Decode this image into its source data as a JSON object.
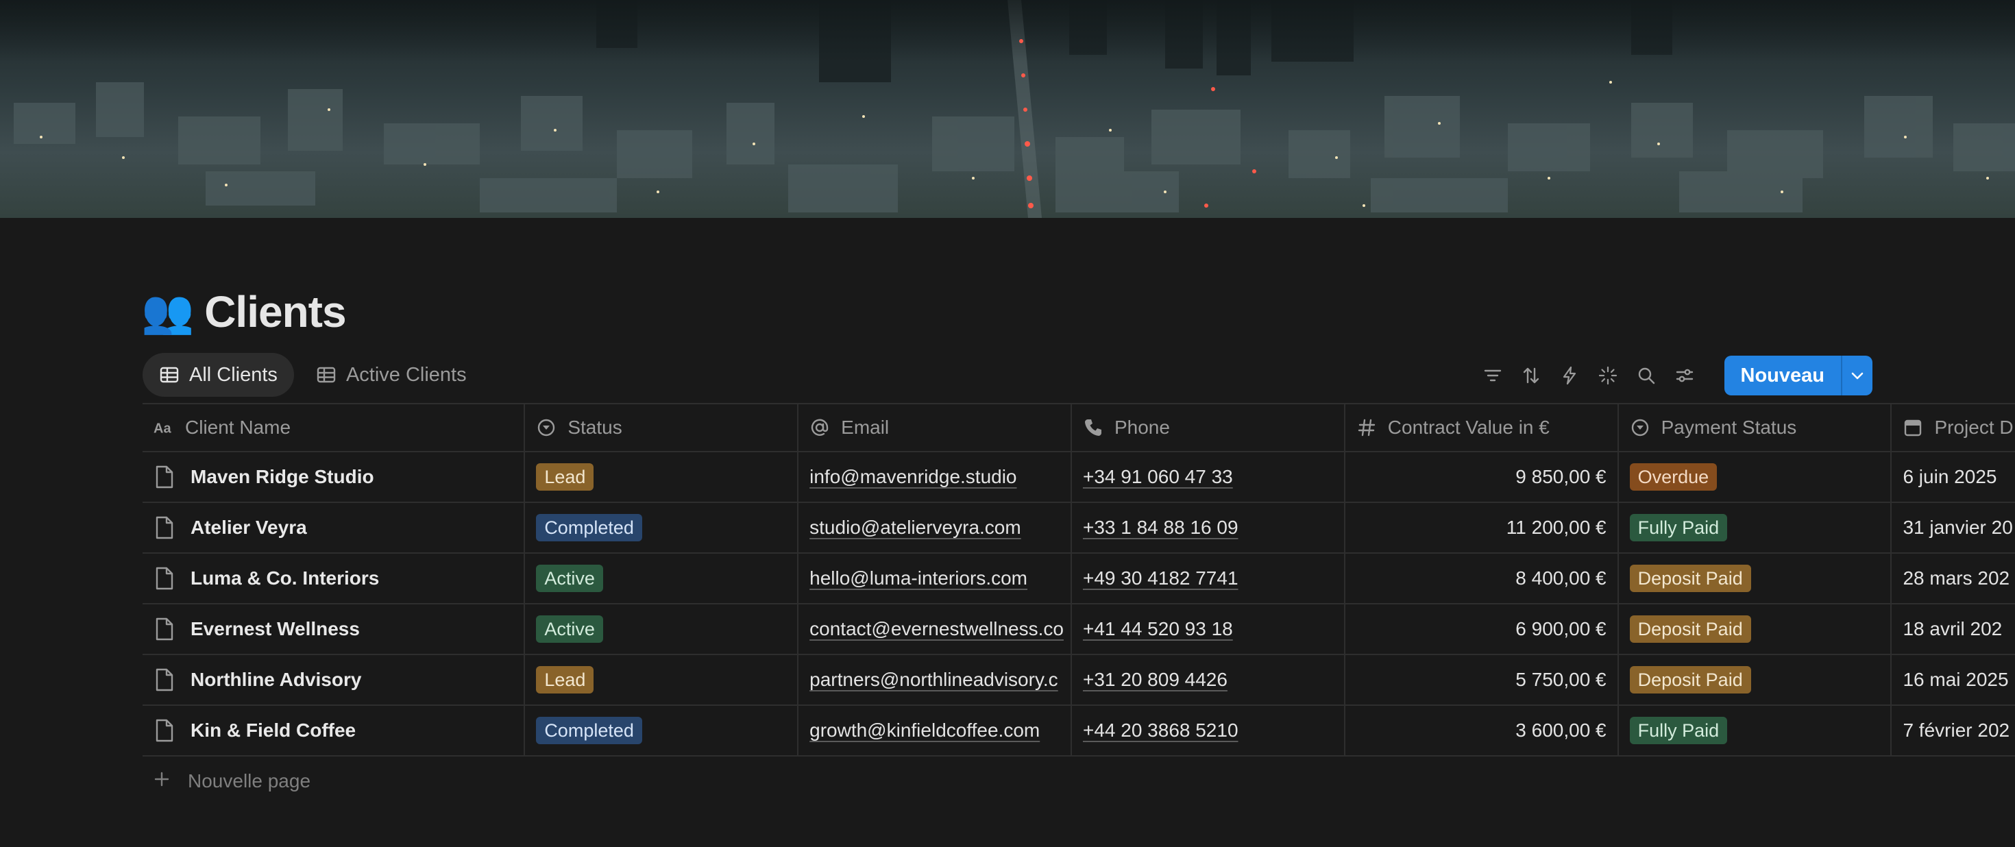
{
  "page": {
    "title_emoji": "👥",
    "title": "Clients"
  },
  "views": [
    {
      "label": "All Clients",
      "active": true
    },
    {
      "label": "Active Clients",
      "active": false
    }
  ],
  "toolbar": {
    "icons": [
      "filter-icon",
      "sort-icon",
      "automation-bolt-icon",
      "ai-sparkle-icon",
      "search-icon",
      "settings-sliders-icon"
    ],
    "new_label": "Nouveau",
    "accent": "#2383e2"
  },
  "table": {
    "columns": [
      {
        "label": "Client Name",
        "icon": "text-aa-icon"
      },
      {
        "label": "Status",
        "icon": "status-icon"
      },
      {
        "label": "Email",
        "icon": "at-icon"
      },
      {
        "label": "Phone",
        "icon": "phone-icon"
      },
      {
        "label": "Contract Value in €",
        "icon": "hash-icon"
      },
      {
        "label": "Payment Status",
        "icon": "status-icon"
      },
      {
        "label": "Project D",
        "icon": "calendar-icon"
      }
    ],
    "rows": [
      {
        "name": "Maven Ridge Studio",
        "status": "Lead",
        "email": "info@mavenridge.studio",
        "phone": "+34 91 060 47 33",
        "value": "9 850,00 €",
        "payment": "Overdue",
        "date": "6 juin 2025"
      },
      {
        "name": "Atelier Veyra",
        "status": "Completed",
        "email": "studio@atelierveyra.com",
        "phone": "+33 1 84 88 16 09",
        "value": "11 200,00 €",
        "payment": "Fully Paid",
        "date": "31 janvier 20"
      },
      {
        "name": "Luma & Co. Interiors",
        "status": "Active",
        "email": "hello@luma-interiors.com",
        "phone": "+49 30 4182 7741",
        "value": "8 400,00 €",
        "payment": "Deposit Paid",
        "date": "28 mars 202"
      },
      {
        "name": "Evernest Wellness",
        "status": "Active",
        "email": "contact@evernestwellness.co",
        "phone": "+41 44 520 93 18",
        "value": "6 900,00 €",
        "payment": "Deposit Paid",
        "date": "18 avril 202"
      },
      {
        "name": "Northline Advisory",
        "status": "Lead",
        "email": "partners@northlineadvisory.c",
        "phone": "+31 20 809 4426",
        "value": "5 750,00 €",
        "payment": "Deposit Paid",
        "date": "16 mai 2025"
      },
      {
        "name": "Kin & Field Coffee",
        "status": "Completed",
        "email": "growth@kinfieldcoffee.com",
        "phone": "+44 20 3868 5210",
        "value": "3 600,00 €",
        "payment": "Fully Paid",
        "date": "7 février 202"
      }
    ],
    "new_page_label": "Nouvelle page"
  },
  "tag_colors": {
    "Lead": "#89632a",
    "Completed": "#28456c",
    "Active": "#2b593f",
    "Overdue": "#854c1d",
    "Fully Paid": "#2b593f",
    "Deposit Paid": "#89632a"
  }
}
